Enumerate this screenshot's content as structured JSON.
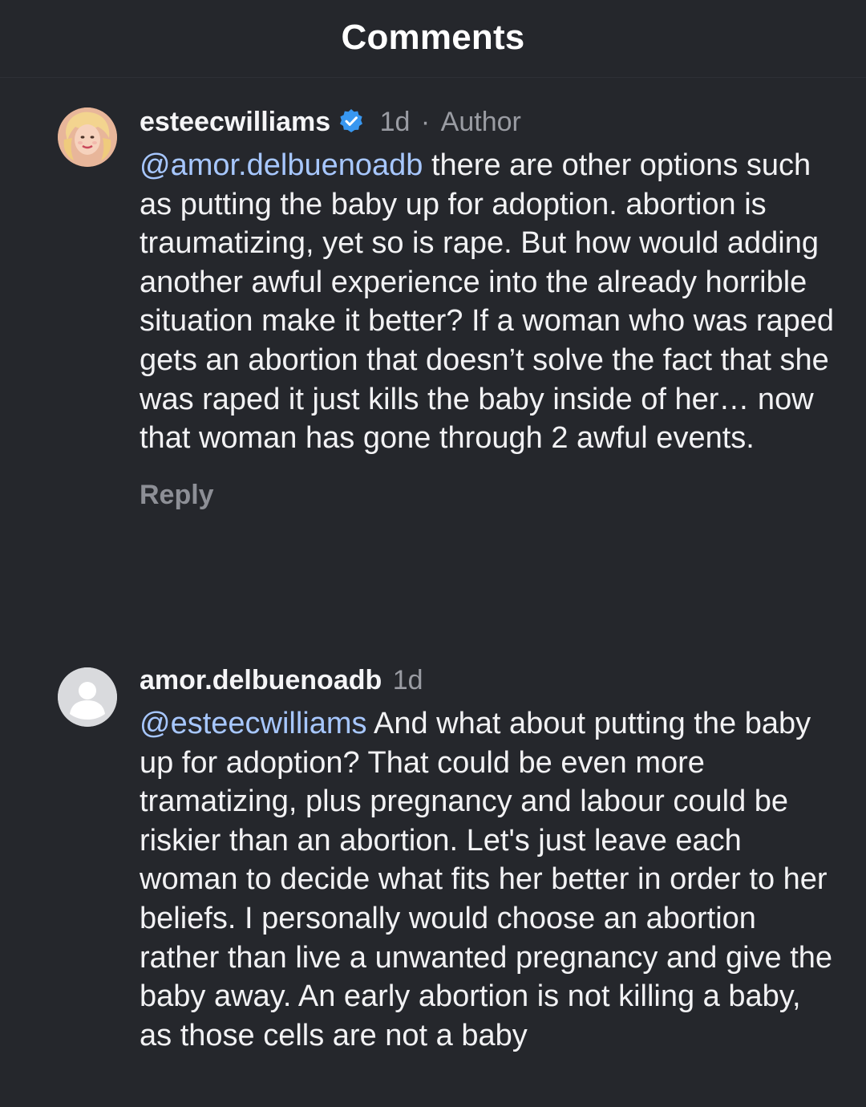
{
  "header": {
    "title": "Comments"
  },
  "comments": [
    {
      "username": "esteecwilliams",
      "verified": true,
      "time": "1d",
      "separator": "·",
      "badge": "Author",
      "avatar_icon": "profile-photo",
      "mention": "@amor.delbuenoadb",
      "text": " there are other options such as putting the baby up for adoption. abortion is traumatizing, yet so is rape. But how would adding another awful experience into the already horrible situation make it better?  If a woman who was raped gets an abortion that doesn’t solve the fact that she was raped it just kills the baby inside of her… now that woman has gone through 2 awful events.",
      "reply_label": "Reply"
    },
    {
      "username": "amor.delbuenoadb",
      "time": "1d",
      "avatar_icon": "default-avatar-icon",
      "mention": "@esteecwilliams",
      "text": " And what about putting the baby up for adoption? That could be even more tramatizing, plus pregnancy and labour could be riskier than an abortion. Let's just leave each woman to decide what fits her better in order to her beliefs. I personally would choose an abortion rather than live a unwanted pregnancy and give the baby away. An early abortion is not killing a baby, as those cells are not a baby"
    }
  ],
  "colors": {
    "background": "#25272c",
    "mention": "#a7c7ff",
    "muted": "#9a9ca3",
    "verified": "#3897f0"
  }
}
